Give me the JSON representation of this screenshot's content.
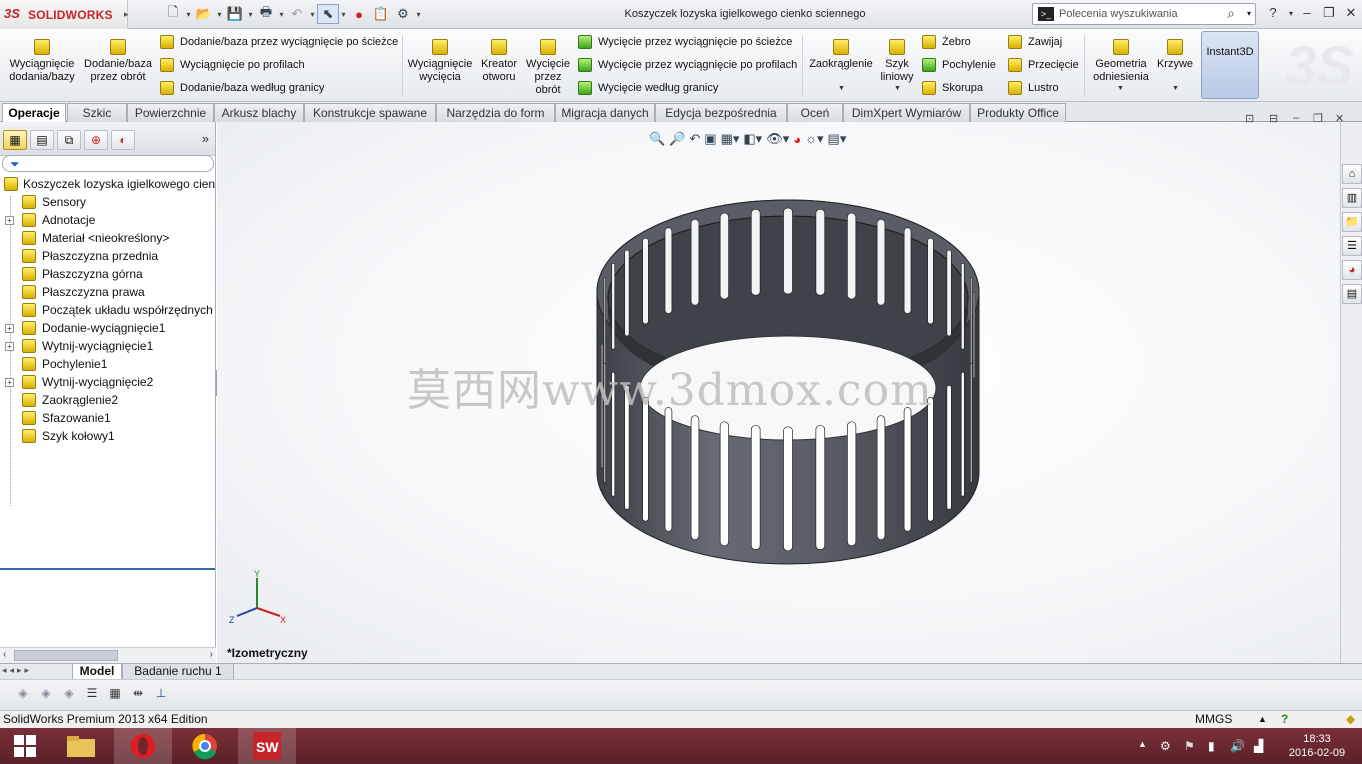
{
  "app": {
    "logo_ds": "3S",
    "logo_text": "SOLIDWORKS",
    "document_title": "Koszyczek lozyska igielkowego cienko sciennego"
  },
  "search": {
    "placeholder": "Polecenia wyszukiwania"
  },
  "ribbon": {
    "extruded_boss": "Wyciągnięcie dodania/bazy",
    "revolved_boss": "Dodanie/baza przez obrót",
    "swept_boss": "Dodanie/baza przez wyciągnięcie po ścieżce",
    "lofted_boss": "Wyciągnięcie po profilach",
    "boundary_boss": "Dodanie/baza według granicy",
    "extruded_cut": "Wyciągnięcie wycięcia",
    "hole_wizard": "Kreator otworu",
    "revolved_cut": "Wycięcie przez obrót",
    "swept_cut": "Wycięcie przez wyciągnięcie po ścieżce",
    "lofted_cut": "Wycięcie przez wyciągnięcie po profilach",
    "boundary_cut": "Wycięcie według granicy",
    "fillet": "Zaokrąglenie",
    "linear_pattern": "Szyk liniowy",
    "rib": "Żebro",
    "draft": "Pochylenie",
    "shell": "Skorupa",
    "wrap": "Zawijaj",
    "intersect": "Przecięcie",
    "mirror": "Lustro",
    "ref_geometry": "Geometria odniesienia",
    "curves": "Krzywe",
    "instant3d": "Instant3D"
  },
  "tabs": [
    "Operacje",
    "Szkic",
    "Powierzchnie",
    "Arkusz blachy",
    "Konstrukcje spawane",
    "Narzędzia do form",
    "Migracja danych",
    "Edycja bezpośrednia",
    "Oceń",
    "DimXpert Wymiarów",
    "Produkty Office"
  ],
  "tree": {
    "root": "Koszyczek lozyska igielkowego cienk",
    "items": [
      {
        "label": "Sensory",
        "expandable": false
      },
      {
        "label": "Adnotacje",
        "expandable": true
      },
      {
        "label": "Materiał <nieokreślony>",
        "expandable": false
      },
      {
        "label": "Płaszczyzna przednia",
        "expandable": false
      },
      {
        "label": "Płaszczyzna górna",
        "expandable": false
      },
      {
        "label": "Płaszczyzna prawa",
        "expandable": false
      },
      {
        "label": "Początek układu współrzędnych",
        "expandable": false
      },
      {
        "label": "Dodanie-wyciągnięcie1",
        "expandable": true
      },
      {
        "label": "Wytnij-wyciągnięcie1",
        "expandable": true
      },
      {
        "label": "Pochylenie1",
        "expandable": false
      },
      {
        "label": "Wytnij-wyciągnięcie2",
        "expandable": true
      },
      {
        "label": "Zaokrąglenie2",
        "expandable": false
      },
      {
        "label": "Sfazowanie1",
        "expandable": false
      },
      {
        "label": "Szyk kołowy1",
        "expandable": false
      }
    ]
  },
  "viewport": {
    "view_name": "*Izometryczny",
    "watermark": "莫西网www.3dmox.com",
    "axis_x": "X",
    "axis_y": "Y",
    "axis_z": "Z"
  },
  "bottom_tabs": [
    "Model",
    "Badanie ruchu 1"
  ],
  "status": {
    "edition": "SolidWorks Premium 2013 x64 Edition",
    "units": "MMGS"
  },
  "taskbar": {
    "time": "18:33",
    "date": "2016-02-09"
  },
  "colors": {
    "accent": "#c5242b",
    "taskbar": "#6b2830",
    "part": "#5d6068"
  }
}
